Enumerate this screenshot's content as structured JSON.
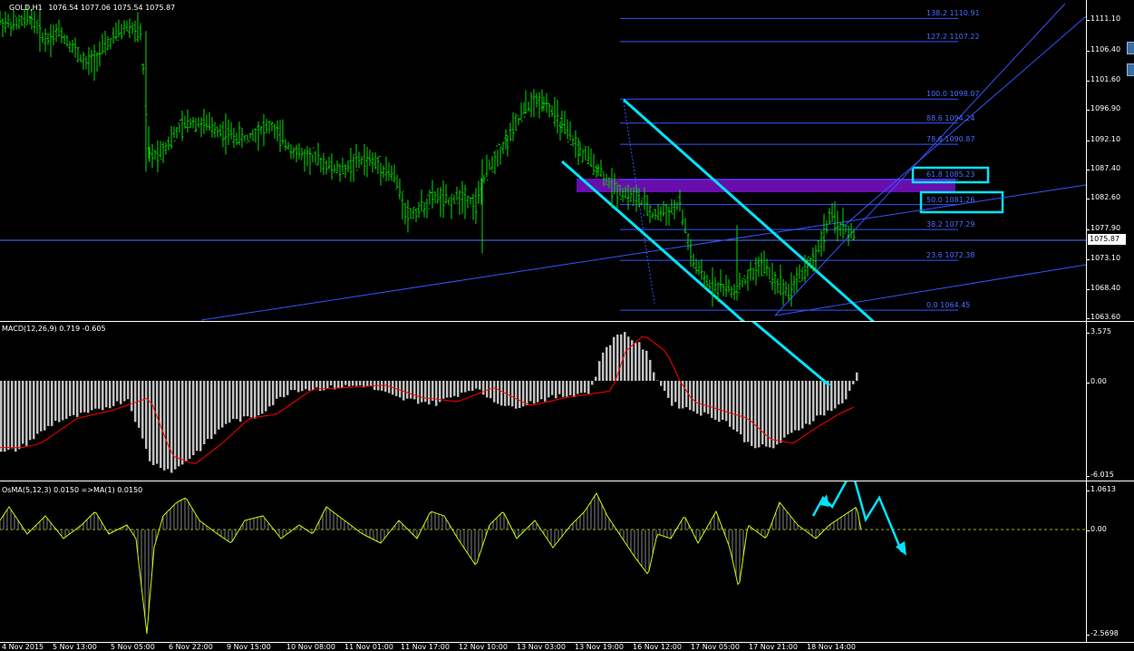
{
  "header": {
    "symbol": "GOLD,H1",
    "ohlc": "1076.54 1077.06 1075.54 1075.87"
  },
  "price_axis": {
    "ticks": [
      "1111.10",
      "1106.40",
      "1101.60",
      "1096.90",
      "1092.10",
      "1087.40",
      "1082.60",
      "1077.90",
      "1073.10",
      "1068.40",
      "1063.60"
    ],
    "current_price": "1075.87"
  },
  "fibo_levels": [
    {
      "label": "138.2  1110.91"
    },
    {
      "label": "127.2  1107.22"
    },
    {
      "label": "100.0  1098.07"
    },
    {
      "label": "88.6  1094.24"
    },
    {
      "label": "78.6  1090.87"
    },
    {
      "label": "61.8  1085.23"
    },
    {
      "label": "50.0  1081.26"
    },
    {
      "label": "38.2  1077.29"
    },
    {
      "label": "23.6  1072.38"
    },
    {
      "label": "0.0  1064.45"
    }
  ],
  "macd": {
    "label": "MACD(12,26,9) 0.719 -0.605",
    "ticks": [
      "3.575",
      "0.00",
      "-6.015"
    ]
  },
  "osma": {
    "label": "OsMA(5,12,3) 0.0150   =>MA(1) 0.0150",
    "ticks": [
      "1.0613",
      "0.00",
      "-2.5698"
    ]
  },
  "time_axis": [
    "4 Nov 2015",
    "5 Nov 13:00",
    "5 Nov 05:00",
    "6 Nov 22:00",
    "9 Nov 15:00",
    "10 Nov 08:00",
    "11 Nov 01:00",
    "11 Nov 17:00",
    "12 Nov 10:00",
    "13 Nov 03:00",
    "13 Nov 19:00",
    "16 Nov 12:00",
    "17 Nov 05:00",
    "17 Nov 21:00",
    "18 Nov 14:00"
  ],
  "colors": {
    "candles": "#00e000",
    "trendline": "#3355ff",
    "channel": "#00e5ff",
    "zone": "#6a0dad",
    "macd_bars": "#c0c0c0",
    "macd_signal": "#ff0000",
    "osma": "#c8ff00"
  },
  "chart_data": {
    "type": "bar",
    "title": "GOLD,H1",
    "series": [
      {
        "name": "GOLD,H1",
        "values": [
          1110.5,
          1109.8,
          1111.0,
          1107.5,
          1108.9,
          1106.4,
          1103.5,
          1105.3,
          1107.8,
          1109.6,
          1108.7,
          1088.7,
          1090.2,
          1092.8,
          1094.6,
          1094.0,
          1093.2,
          1092.4,
          1091.7,
          1093.1,
          1093.7,
          1091.0,
          1089.2,
          1088.7,
          1087.7,
          1086.6,
          1087.9,
          1088.5,
          1087.4,
          1085.8,
          1079.5,
          1080.8,
          1082.6,
          1081.6,
          1082.9,
          1081.3,
          1087.5,
          1091.5,
          1096.8,
          1098.0,
          1093.7,
          1089.8,
          1086.9,
          1084.2,
          1083.0,
          1082.1,
          1079.6,
          1080.1,
          1081.1,
          1071.8,
          1068.8,
          1068.2,
          1067.4,
          1069.4,
          1072.0,
          1069.2,
          1067.6,
          1070.6,
          1073.1,
          1079.2,
          1076.0
        ]
      }
    ],
    "ylim": [
      1063.6,
      1111.1
    ],
    "grid": false
  }
}
